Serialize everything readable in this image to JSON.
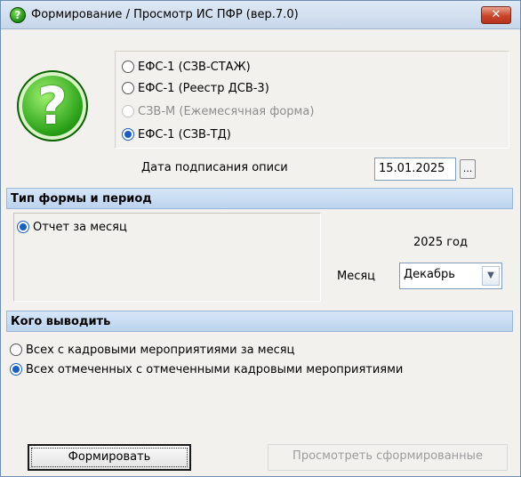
{
  "window": {
    "title": "Формирование / Просмотр ИС ПФР (вер.7.0)",
    "close_label": "✕"
  },
  "form_types": [
    {
      "label": "ЕФС-1 (СЗВ-СТАЖ)",
      "selected": false,
      "enabled": true
    },
    {
      "label": "ЕФС-1 (Реестр ДСВ-3)",
      "selected": false,
      "enabled": true
    },
    {
      "label": "СЗВ-М (Ежемесячная форма)",
      "selected": false,
      "enabled": false
    },
    {
      "label": "ЕФС-1 (СЗВ-ТД)",
      "selected": true,
      "enabled": true
    }
  ],
  "signing": {
    "label": "Дата подписания описи",
    "date": "15.01.2025",
    "picker_label": "..."
  },
  "period_section": {
    "header": "Тип формы и период",
    "option": "Отчет за месяц",
    "year_text": "2025 год",
    "month_label": "Месяц",
    "month_value": "Декабрь"
  },
  "output_section": {
    "header": "Кого выводить",
    "options": [
      {
        "label": "Всех с кадровыми мероприятиями за месяц",
        "selected": false
      },
      {
        "label": "Всех отмеченных с отмеченными кадровыми мероприятиями",
        "selected": true
      }
    ]
  },
  "actions": {
    "generate": "Формировать",
    "view_generated": "Просмотреть сформированные"
  },
  "colors": {
    "accent": "#1a5fc0",
    "section_header": "#c8dcf2",
    "window_bg": "#f3f1ed"
  }
}
